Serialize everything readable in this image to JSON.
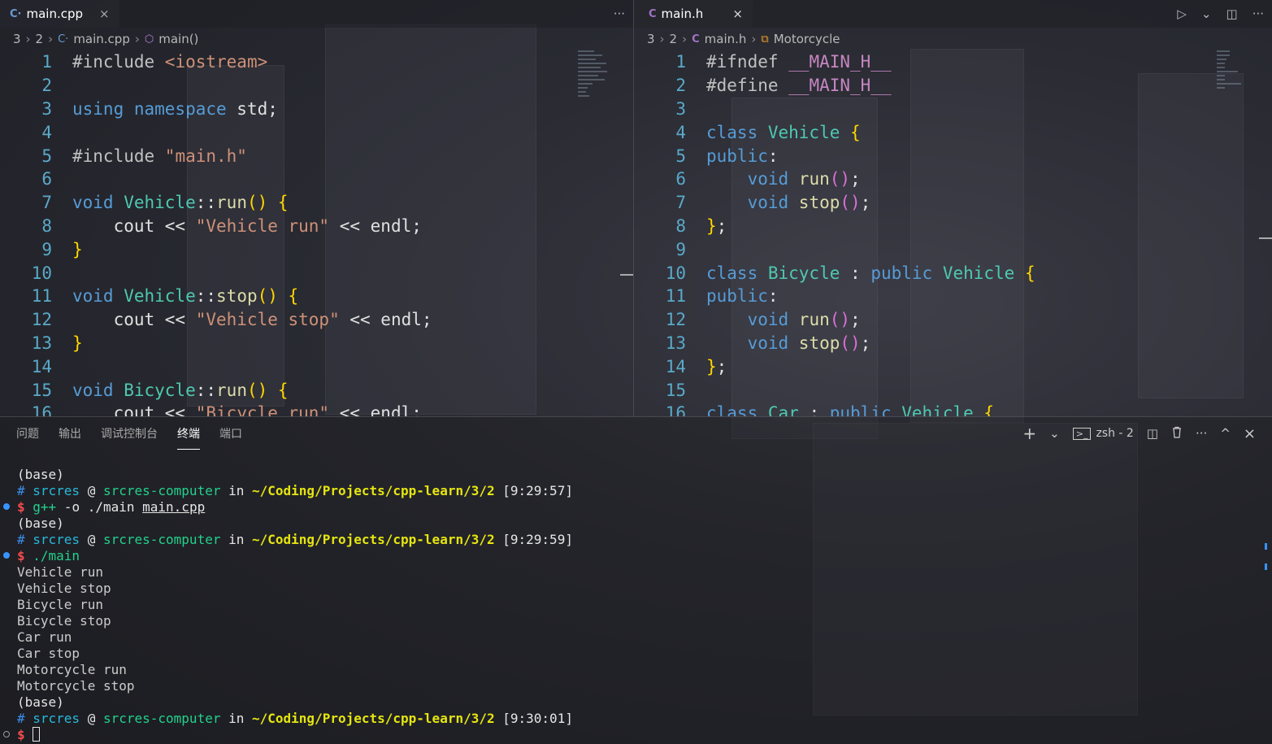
{
  "left_editor": {
    "tab": {
      "icon": "C++",
      "label": "main.cpp",
      "close": "×"
    },
    "more": "···",
    "breadcrumb": [
      "3",
      "2",
      "main.cpp",
      "main()"
    ],
    "lines": [
      {
        "n": "1",
        "tokens": [
          [
            "pp",
            "#include "
          ],
          [
            "inc",
            "<iostream>"
          ]
        ]
      },
      {
        "n": "2",
        "tokens": []
      },
      {
        "n": "3",
        "tokens": [
          [
            "kw",
            "using "
          ],
          [
            "kw",
            "namespace "
          ],
          [
            "plain",
            "std;"
          ]
        ]
      },
      {
        "n": "4",
        "tokens": []
      },
      {
        "n": "5",
        "tokens": [
          [
            "pp",
            "#include "
          ],
          [
            "inc",
            "\"main.h\""
          ]
        ]
      },
      {
        "n": "6",
        "tokens": []
      },
      {
        "n": "7",
        "tokens": [
          [
            "kw",
            "void "
          ],
          [
            "cls",
            "Vehicle"
          ],
          [
            "plain",
            "::"
          ],
          [
            "fn",
            "run"
          ],
          [
            "brace",
            "() {"
          ]
        ]
      },
      {
        "n": "8",
        "tokens": [
          [
            "plain",
            "    cout << "
          ],
          [
            "str",
            "\"Vehicle run\""
          ],
          [
            "plain",
            " << endl;"
          ]
        ]
      },
      {
        "n": "9",
        "tokens": [
          [
            "brace",
            "}"
          ]
        ]
      },
      {
        "n": "10",
        "tokens": []
      },
      {
        "n": "11",
        "tokens": [
          [
            "kw",
            "void "
          ],
          [
            "cls",
            "Vehicle"
          ],
          [
            "plain",
            "::"
          ],
          [
            "fn",
            "stop"
          ],
          [
            "brace",
            "() {"
          ]
        ]
      },
      {
        "n": "12",
        "tokens": [
          [
            "plain",
            "    cout << "
          ],
          [
            "str",
            "\"Vehicle stop\""
          ],
          [
            "plain",
            " << endl;"
          ]
        ]
      },
      {
        "n": "13",
        "tokens": [
          [
            "brace",
            "}"
          ]
        ]
      },
      {
        "n": "14",
        "tokens": []
      },
      {
        "n": "15",
        "tokens": [
          [
            "kw",
            "void "
          ],
          [
            "cls",
            "Bicycle"
          ],
          [
            "plain",
            "::"
          ],
          [
            "fn",
            "run"
          ],
          [
            "brace",
            "() {"
          ]
        ]
      },
      {
        "n": "16",
        "tokens": [
          [
            "plain",
            "    cout << "
          ],
          [
            "str",
            "\"Bicycle run\""
          ],
          [
            "plain",
            " << endl;"
          ]
        ]
      }
    ]
  },
  "right_editor": {
    "tab": {
      "icon": "C",
      "label": "main.h",
      "close": "×"
    },
    "actions": [
      "▷",
      "⌄",
      "◫",
      "···"
    ],
    "breadcrumb": [
      "3",
      "2",
      "main.h",
      "Motorcycle"
    ],
    "lines": [
      {
        "n": "1",
        "tokens": [
          [
            "pp",
            "#ifndef "
          ],
          [
            "macro",
            "__MAIN_H__"
          ]
        ]
      },
      {
        "n": "2",
        "tokens": [
          [
            "pp",
            "#define "
          ],
          [
            "macro",
            "__MAIN_H__"
          ]
        ]
      },
      {
        "n": "3",
        "tokens": []
      },
      {
        "n": "4",
        "tokens": [
          [
            "kw",
            "class "
          ],
          [
            "cls",
            "Vehicle "
          ],
          [
            "brace",
            "{"
          ]
        ]
      },
      {
        "n": "5",
        "tokens": [
          [
            "kw",
            "public"
          ],
          [
            "plain",
            ":"
          ]
        ]
      },
      {
        "n": "6",
        "tokens": [
          [
            "plain",
            "    "
          ],
          [
            "kw",
            "void "
          ],
          [
            "fn",
            "run"
          ],
          [
            "brace2",
            "()"
          ],
          [
            "plain",
            ";"
          ]
        ]
      },
      {
        "n": "7",
        "tokens": [
          [
            "plain",
            "    "
          ],
          [
            "kw",
            "void "
          ],
          [
            "fn",
            "stop"
          ],
          [
            "brace2",
            "()"
          ],
          [
            "plain",
            ";"
          ]
        ]
      },
      {
        "n": "8",
        "tokens": [
          [
            "brace",
            "}"
          ],
          [
            "plain",
            ";"
          ]
        ]
      },
      {
        "n": "9",
        "tokens": []
      },
      {
        "n": "10",
        "tokens": [
          [
            "kw",
            "class "
          ],
          [
            "cls",
            "Bicycle "
          ],
          [
            "plain",
            ": "
          ],
          [
            "kw",
            "public "
          ],
          [
            "cls",
            "Vehicle "
          ],
          [
            "brace",
            "{"
          ]
        ]
      },
      {
        "n": "11",
        "tokens": [
          [
            "kw",
            "public"
          ],
          [
            "plain",
            ":"
          ]
        ]
      },
      {
        "n": "12",
        "tokens": [
          [
            "plain",
            "    "
          ],
          [
            "kw",
            "void "
          ],
          [
            "fn",
            "run"
          ],
          [
            "brace2",
            "()"
          ],
          [
            "plain",
            ";"
          ]
        ]
      },
      {
        "n": "13",
        "tokens": [
          [
            "plain",
            "    "
          ],
          [
            "kw",
            "void "
          ],
          [
            "fn",
            "stop"
          ],
          [
            "brace2",
            "()"
          ],
          [
            "plain",
            ";"
          ]
        ]
      },
      {
        "n": "14",
        "tokens": [
          [
            "brace",
            "}"
          ],
          [
            "plain",
            ";"
          ]
        ]
      },
      {
        "n": "15",
        "tokens": []
      },
      {
        "n": "16",
        "tokens": [
          [
            "kw",
            "class "
          ],
          [
            "cls",
            "Car "
          ],
          [
            "plain",
            ": "
          ],
          [
            "kw",
            "public "
          ],
          [
            "cls",
            "Vehicle "
          ],
          [
            "brace",
            "{"
          ]
        ]
      }
    ]
  },
  "panel": {
    "tabs": [
      "问题",
      "输出",
      "调试控制台",
      "终端",
      "端口"
    ],
    "active_tab": "终端",
    "actions": {
      "add": "+",
      "dropdown": "⌄",
      "shell": "zsh - 2",
      "split": "◫",
      "trash": "🗑",
      "more": "···",
      "maximize": "^",
      "close": "×"
    }
  },
  "terminal": {
    "lines": [
      {
        "dot": "",
        "parts": [
          [
            "t-plain",
            "(base)"
          ]
        ]
      },
      {
        "dot": "",
        "parts": [
          [
            "t-blue",
            "# "
          ],
          [
            "t-cyan",
            "srcres"
          ],
          [
            "t-plain",
            " @ "
          ],
          [
            "t-green",
            "srcres-computer"
          ],
          [
            "t-plain",
            " in "
          ],
          [
            "t-yellow",
            "~/Coding/Projects/cpp-learn/3/2"
          ],
          [
            "t-plain",
            " [9:29:57]"
          ]
        ]
      },
      {
        "dot": "blue",
        "parts": [
          [
            "t-red",
            "$ "
          ],
          [
            "t-green",
            "g++"
          ],
          [
            "t-plain",
            " -o ./main "
          ],
          [
            "t-plain underline",
            "main.cpp"
          ]
        ]
      },
      {
        "dot": "",
        "parts": [
          [
            "t-plain",
            "(base)"
          ]
        ]
      },
      {
        "dot": "",
        "parts": [
          [
            "t-blue",
            "# "
          ],
          [
            "t-cyan",
            "srcres"
          ],
          [
            "t-plain",
            " @ "
          ],
          [
            "t-green",
            "srcres-computer"
          ],
          [
            "t-plain",
            " in "
          ],
          [
            "t-yellow",
            "~/Coding/Projects/cpp-learn/3/2"
          ],
          [
            "t-plain",
            " [9:29:59]"
          ]
        ]
      },
      {
        "dot": "blue",
        "parts": [
          [
            "t-red",
            "$ "
          ],
          [
            "t-green",
            "./main"
          ]
        ]
      },
      {
        "dot": "",
        "parts": [
          [
            "t-out",
            "Vehicle run"
          ]
        ]
      },
      {
        "dot": "",
        "parts": [
          [
            "t-out",
            "Vehicle stop"
          ]
        ]
      },
      {
        "dot": "",
        "parts": [
          [
            "t-out",
            "Bicycle run"
          ]
        ]
      },
      {
        "dot": "",
        "parts": [
          [
            "t-out",
            "Bicycle stop"
          ]
        ]
      },
      {
        "dot": "",
        "parts": [
          [
            "t-out",
            "Car run"
          ]
        ]
      },
      {
        "dot": "",
        "parts": [
          [
            "t-out",
            "Car stop"
          ]
        ]
      },
      {
        "dot": "",
        "parts": [
          [
            "t-out",
            "Motorcycle run"
          ]
        ]
      },
      {
        "dot": "",
        "parts": [
          [
            "t-out",
            "Motorcycle stop"
          ]
        ]
      },
      {
        "dot": "",
        "parts": [
          [
            "t-plain",
            "(base)"
          ]
        ]
      },
      {
        "dot": "",
        "parts": [
          [
            "t-blue",
            "# "
          ],
          [
            "t-cyan",
            "srcres"
          ],
          [
            "t-plain",
            " @ "
          ],
          [
            "t-green",
            "srcres-computer"
          ],
          [
            "t-plain",
            " in "
          ],
          [
            "t-yellow",
            "~/Coding/Projects/cpp-learn/3/2"
          ],
          [
            "t-plain",
            " [9:30:01]"
          ]
        ]
      },
      {
        "dot": "hollow",
        "parts": [
          [
            "t-red",
            "$ "
          ]
        ],
        "cursor": true
      }
    ]
  }
}
